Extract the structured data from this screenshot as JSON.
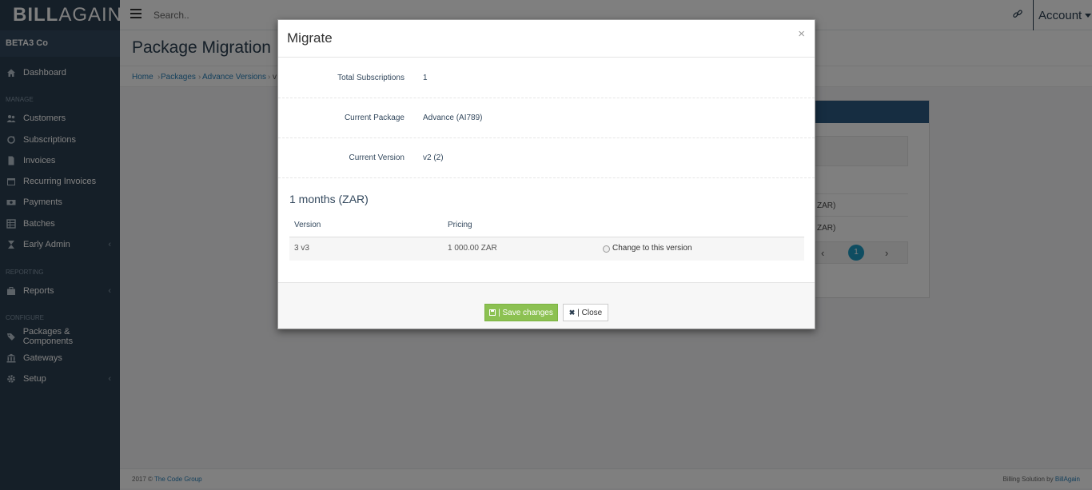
{
  "brand": {
    "part1": "BILL",
    "part2": "AGAIN"
  },
  "topbar": {
    "search_placeholder": "Search..",
    "account_label": "Account"
  },
  "sidebar": {
    "company": "BETA3 Co",
    "dashboard": "Dashboard",
    "section_manage": "MANAGE",
    "customers": "Customers",
    "subscriptions": "Subscriptions",
    "invoices": "Invoices",
    "recurring_invoices": "Recurring Invoices",
    "payments": "Payments",
    "batches": "Batches",
    "early_admin": "Early Admin",
    "section_reporting": "REPORTING",
    "reports": "Reports",
    "section_configure": "CONFIGURE",
    "packages_components": "Packages & Components",
    "gateways": "Gateways",
    "setup": "Setup"
  },
  "page": {
    "title": "Package Migration",
    "breadcrumb": [
      "Home",
      "Packages",
      "Advance Versions",
      "v"
    ],
    "panel_rows": [
      "ZAR)",
      "ZAR)"
    ],
    "pager_current": "1"
  },
  "footer": {
    "left_prefix": "2017 © ",
    "left_link": "The Code Group",
    "right_prefix": "Billing Solution by ",
    "right_link": "BillAgain"
  },
  "modal": {
    "title": "Migrate",
    "close_symbol": "×",
    "details": [
      {
        "label": "Total Subscriptions",
        "value": "1"
      },
      {
        "label": "Current Package",
        "value": "Advance (AI789)"
      },
      {
        "label": "Current Version",
        "value": "v2 (2)"
      }
    ],
    "period_title": "1 months (ZAR)",
    "table": {
      "headers": [
        "Version",
        "Pricing"
      ],
      "rows": [
        {
          "version": "3 v3",
          "pricing": "1 000.00 ZAR",
          "action": "Change to this version"
        }
      ]
    },
    "save_label": "| Save changes",
    "close_label": "| Close"
  }
}
